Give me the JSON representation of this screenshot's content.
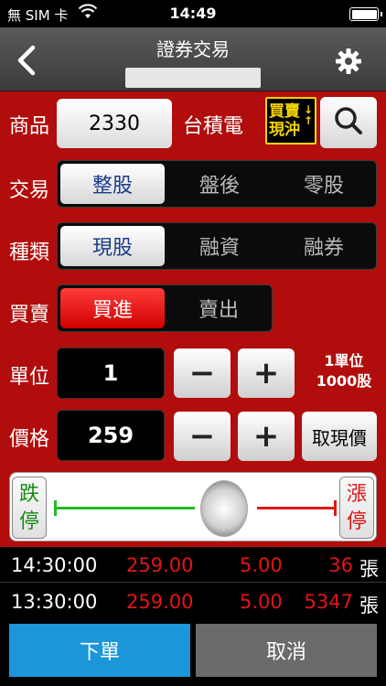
{
  "status_bar": {
    "carrier": "無 SIM 卡",
    "time": "14:49"
  },
  "header": {
    "title": "證券交易",
    "icons": {
      "back": "chevron-left-icon",
      "settings": "gear-icon"
    }
  },
  "product": {
    "label": "商品",
    "code": "2330",
    "name": "台積電",
    "swap_label_line1": "買賣",
    "swap_label_line2": "現沖",
    "search_icon": "search-icon"
  },
  "trade": {
    "label": "交易",
    "options": [
      "整股",
      "盤後",
      "零股"
    ],
    "selected": "整股"
  },
  "category": {
    "label": "種類",
    "options": [
      "現股",
      "融資",
      "融券"
    ],
    "selected": "現股"
  },
  "side": {
    "label": "買賣",
    "options": [
      "買進",
      "賣出"
    ],
    "selected": "買進"
  },
  "unit": {
    "label": "單位",
    "value": "1",
    "minus": "−",
    "plus": "+",
    "note_line1": "1單位",
    "note_line2": "1000股"
  },
  "price": {
    "label": "價格",
    "value": "259",
    "minus": "−",
    "plus": "+",
    "market_button": "取現價"
  },
  "price_slider": {
    "down_limit_line1": "跌",
    "down_limit_line2": "停",
    "up_limit_line1": "漲",
    "up_limit_line2": "停",
    "position": 0.6,
    "colors": {
      "down": "#22bb22",
      "up": "#e01818"
    }
  },
  "quotes": [
    {
      "time": "14:30:00",
      "price": "259.00",
      "change": "5.00",
      "volume": "36",
      "unit": "張"
    },
    {
      "time": "13:30:00",
      "price": "259.00",
      "change": "5.00",
      "volume": "5347",
      "unit": "張"
    }
  ],
  "actions": {
    "submit": "下單",
    "cancel": "取消"
  },
  "colors": {
    "form_background": "#b20d0d",
    "submit": "#1a96d9",
    "cancel": "#6b6b6b",
    "price_red": "#e51414"
  }
}
